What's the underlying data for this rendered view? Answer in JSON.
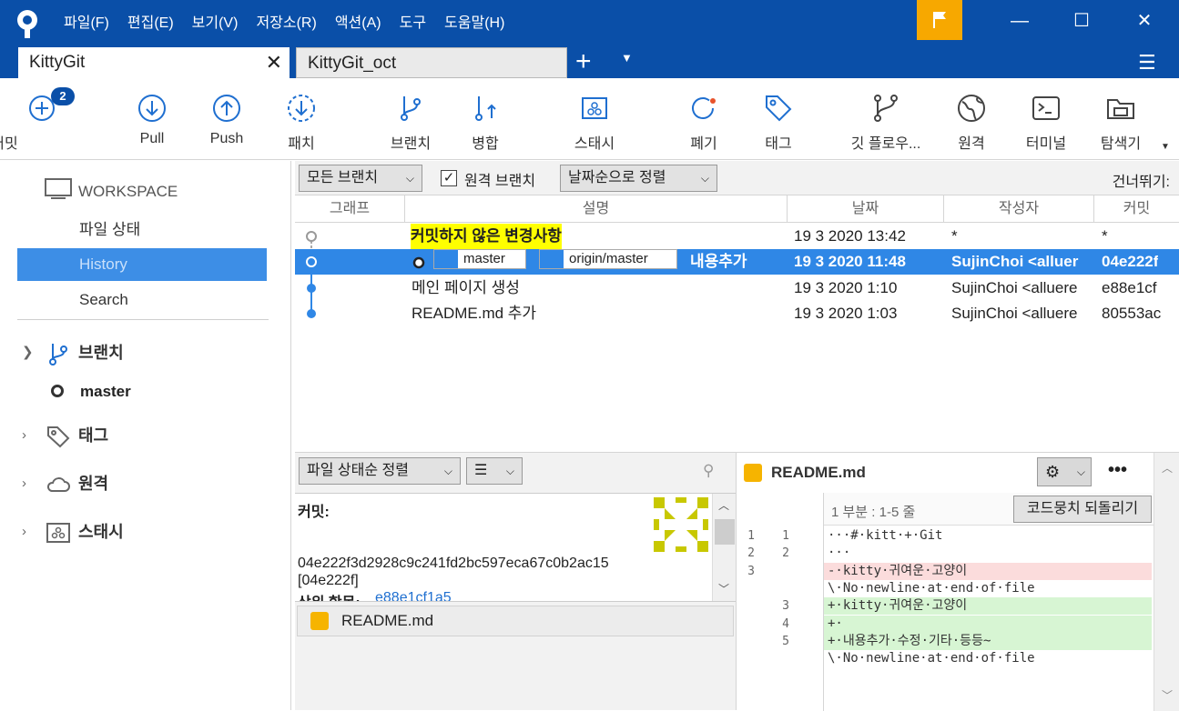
{
  "menu": [
    "파일(F)",
    "편집(E)",
    "보기(V)",
    "저장소(R)",
    "액션(A)",
    "도구",
    "도움말(H)"
  ],
  "tabs": {
    "active": "KittyGit",
    "inactive": "KittyGit_oct"
  },
  "toolbar": {
    "commit": "커밋",
    "commit_badge": "2",
    "pull": "Pull",
    "push": "Push",
    "fetch": "패치",
    "branch": "브랜치",
    "merge": "병합",
    "stash": "스태시",
    "discard": "폐기",
    "tag": "태그",
    "gitflow": "깃 플로우...",
    "remote": "원격",
    "terminal": "터미널",
    "explorer": "탐색기"
  },
  "sidebar": {
    "workspace": "WORKSPACE",
    "items": [
      "파일 상태",
      "History",
      "Search"
    ],
    "branches": "브랜치",
    "current_branch": "master",
    "tags": "태그",
    "remotes": "원격",
    "stashes": "스태시"
  },
  "filter": {
    "branches": "모든 브랜치",
    "remote_branch": "원격 브랜치",
    "sort": "날짜순으로 정렬",
    "skip": "건너뛰기:"
  },
  "columns": [
    "그래프",
    "설명",
    "날짜",
    "작성자",
    "커밋"
  ],
  "rows": [
    {
      "desc": "커밋하지 않은 변경사항",
      "date": "19 3 2020 13:42",
      "author": "*",
      "commit": "*"
    },
    {
      "desc": "내용추가",
      "tag1": "master",
      "tag2": "origin/master",
      "date": "19 3 2020 11:48",
      "author": "SujinChoi <alluer",
      "commit": "04e222f"
    },
    {
      "desc": "메인 페이지 생성",
      "date": "19 3 2020 1:10",
      "author": "SujinChoi <alluere",
      "commit": "e88e1cf"
    },
    {
      "desc": "README.md 추가",
      "date": "19 3 2020 1:03",
      "author": "SujinChoi <alluere",
      "commit": "80553ac"
    }
  ],
  "lower_left": {
    "sort": "파일 상태순 정렬",
    "commit_label": "커밋:",
    "hash": "04e222f3d2928c9c241fd2bc597eca67c0b2ac15",
    "short": "[04e222f]",
    "parent_label": "상위 항목:",
    "parent": "e88e1cf1a5",
    "file": "README.md"
  },
  "diff": {
    "file": "README.md",
    "hunk": "1 부분 : 1-5 줄",
    "revert": "코드뭉치 되돌리기",
    "lines": [
      {
        "old": "1",
        "new": "1",
        "text": "···#·kitt·+·Git",
        "kind": "ctx"
      },
      {
        "old": "2",
        "new": "2",
        "text": "···",
        "kind": "ctx"
      },
      {
        "old": "3",
        "new": "",
        "text": "-·kitty·귀여운·고양이",
        "kind": "del"
      },
      {
        "old": "",
        "new": "",
        "text": "\\·No·newline·at·end·of·file",
        "kind": "ctx"
      },
      {
        "old": "",
        "new": "3",
        "text": "+·kitty·귀여운·고양이",
        "kind": "add"
      },
      {
        "old": "",
        "new": "4",
        "text": "+·",
        "kind": "add"
      },
      {
        "old": "",
        "new": "5",
        "text": "+·내용추가·수정·기타·등등~",
        "kind": "add"
      },
      {
        "old": "",
        "new": "",
        "text": "\\·No·newline·at·end·of·file",
        "kind": "ctx"
      }
    ]
  },
  "colors": {
    "title": "#0a4fa8",
    "selection": "#2f87e6",
    "add": "#d7f5d3",
    "del": "#fbdcdc",
    "flag": "#f7a800"
  }
}
